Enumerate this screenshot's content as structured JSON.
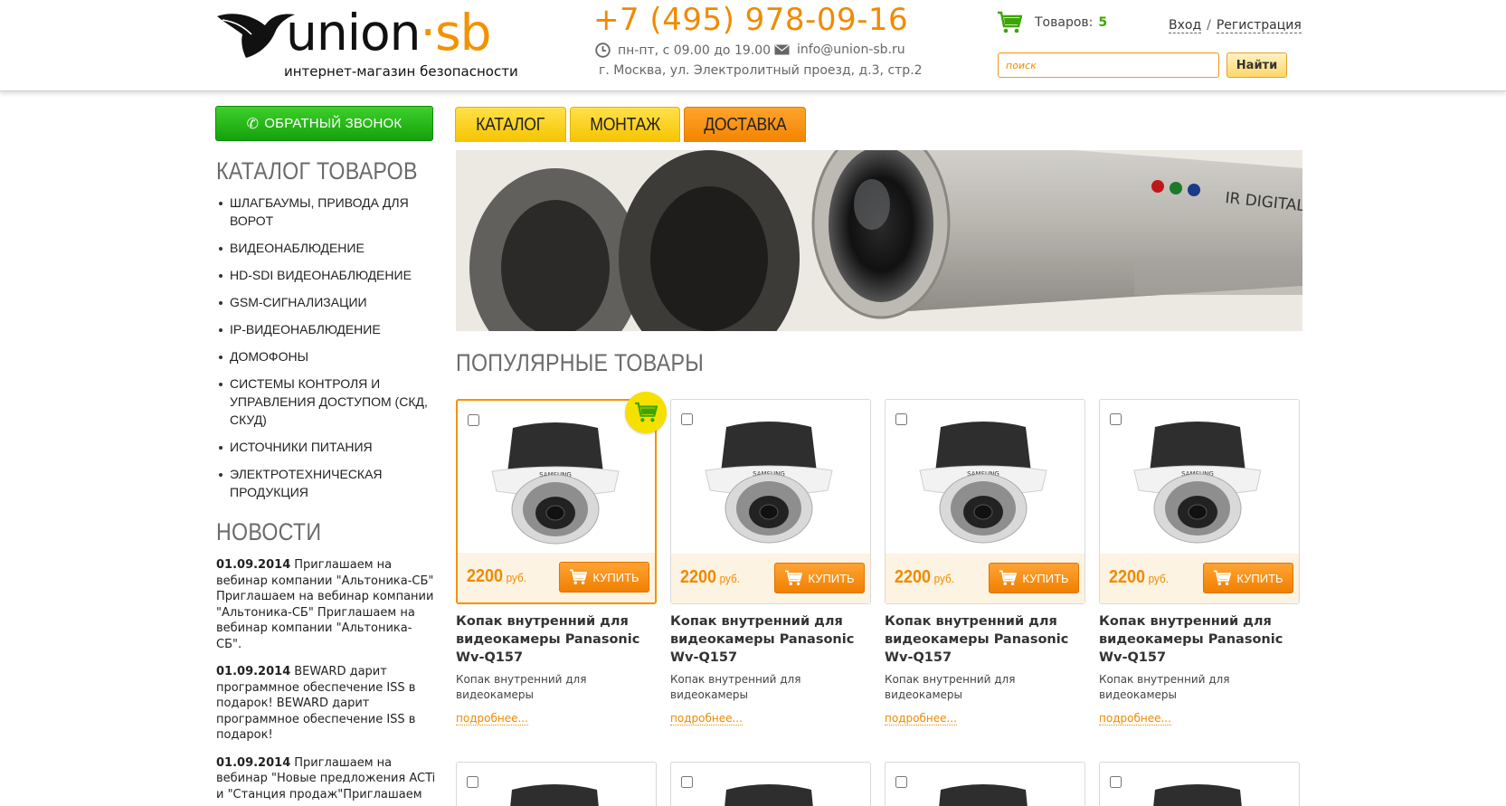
{
  "header": {
    "logo_main": "union",
    "logo_dot": "·",
    "logo_sb": "sb",
    "logo_tagline": "интернет-магазин безопасности",
    "phone": "+7 (495) 978-09-16",
    "hours": "пн-пт, с 09.00 до 19.00",
    "email": "info@union-sb.ru",
    "address": "г. Москва, ул. Электролитный проезд, д.3, стр.2",
    "cart_label": "Товаров:",
    "cart_count": "5",
    "login": "Вход",
    "auth_sep": "/",
    "register": "Регистрация",
    "search_placeholder": "поиск",
    "search_button": "Найти"
  },
  "sidebar": {
    "callback_button": "ОБРАТНЫЙ ЗВОНОК",
    "catalog_title": "КАТАЛОГ ТОВАРОВ",
    "catalog_items": [
      "ШЛАГБАУМЫ, ПРИВОДА ДЛЯ ВОРОТ",
      "ВИДЕОНАБЛЮДЕНИЕ",
      "HD-SDI ВИДЕОНАБЛЮДЕНИЕ",
      "GSM-СИГНАЛИЗАЦИИ",
      "IP-ВИДЕОНАБЛЮДЕНИЕ",
      "ДОМОФОНЫ",
      "СИСТЕМЫ КОНТРОЛЯ И УПРАВЛЕНИЯ ДОСТУПОМ (СКД, СКУД)",
      "ИСТОЧНИКИ ПИТАНИЯ",
      "ЭЛЕКТРОТЕХНИЧЕСКАЯ ПРОДУКЦИЯ"
    ],
    "news_title": "НОВОСТИ",
    "news": [
      {
        "date": "01.09.2014",
        "text": "Приглашаем на вебинар компании \"Альтоника-СБ\" Приглашаем на вебинар компании \"Альтоника-СБ\" Приглашаем на вебинар компании \"Альтоника-СБ\"."
      },
      {
        "date": "01.09.2014",
        "text": "BEWARD дарит программное обеспечение ISS в подарок! BEWARD дарит программное обеспечение ISS в подарок!"
      },
      {
        "date": "01.09.2014",
        "text": "Приглашаем на вебинар \"Новые предложения ACTi и \"Станция продаж\"Приглашаем"
      }
    ]
  },
  "tabs": [
    {
      "label": "КАТАЛОГ",
      "active": false
    },
    {
      "label": "МОНТАЖ",
      "active": false
    },
    {
      "label": "ДОСТАВКА",
      "active": true
    }
  ],
  "banner": {
    "camera_text": "IR DIGITAL"
  },
  "popular_title": "ПОПУЛЯРНЫЕ ТОВАРЫ",
  "camera_brand": "SAMSUNG",
  "products": [
    {
      "price": "2200",
      "currency": "руб.",
      "buy": "КУПИТЬ",
      "name": "Копак внутренний для видеокамеры Panasonic Wv-Q157",
      "desc": "Копак внутренний для видеокамеры",
      "more": "подробнее..."
    },
    {
      "price": "2200",
      "currency": "руб.",
      "buy": "КУПИТЬ",
      "name": "Копак внутренний для видеокамеры Panasonic Wv-Q157",
      "desc": "Копак внутренний для видеокамеры",
      "more": "подробнее..."
    },
    {
      "price": "2200",
      "currency": "руб.",
      "buy": "КУПИТЬ",
      "name": "Копак внутренний для видеокамеры Panasonic Wv-Q157",
      "desc": "Копак внутренний для видеокамеры",
      "more": "подробнее..."
    },
    {
      "price": "2200",
      "currency": "руб.",
      "buy": "КУПИТЬ",
      "name": "Копак внутренний для видеокамеры Panasonic Wv-Q157",
      "desc": "Копак внутренний для видеокамеры",
      "more": "подробнее..."
    }
  ],
  "colors": {
    "accent_orange": "#f39200",
    "green": "#14a20c",
    "tab_yellow": "#f6c400"
  }
}
